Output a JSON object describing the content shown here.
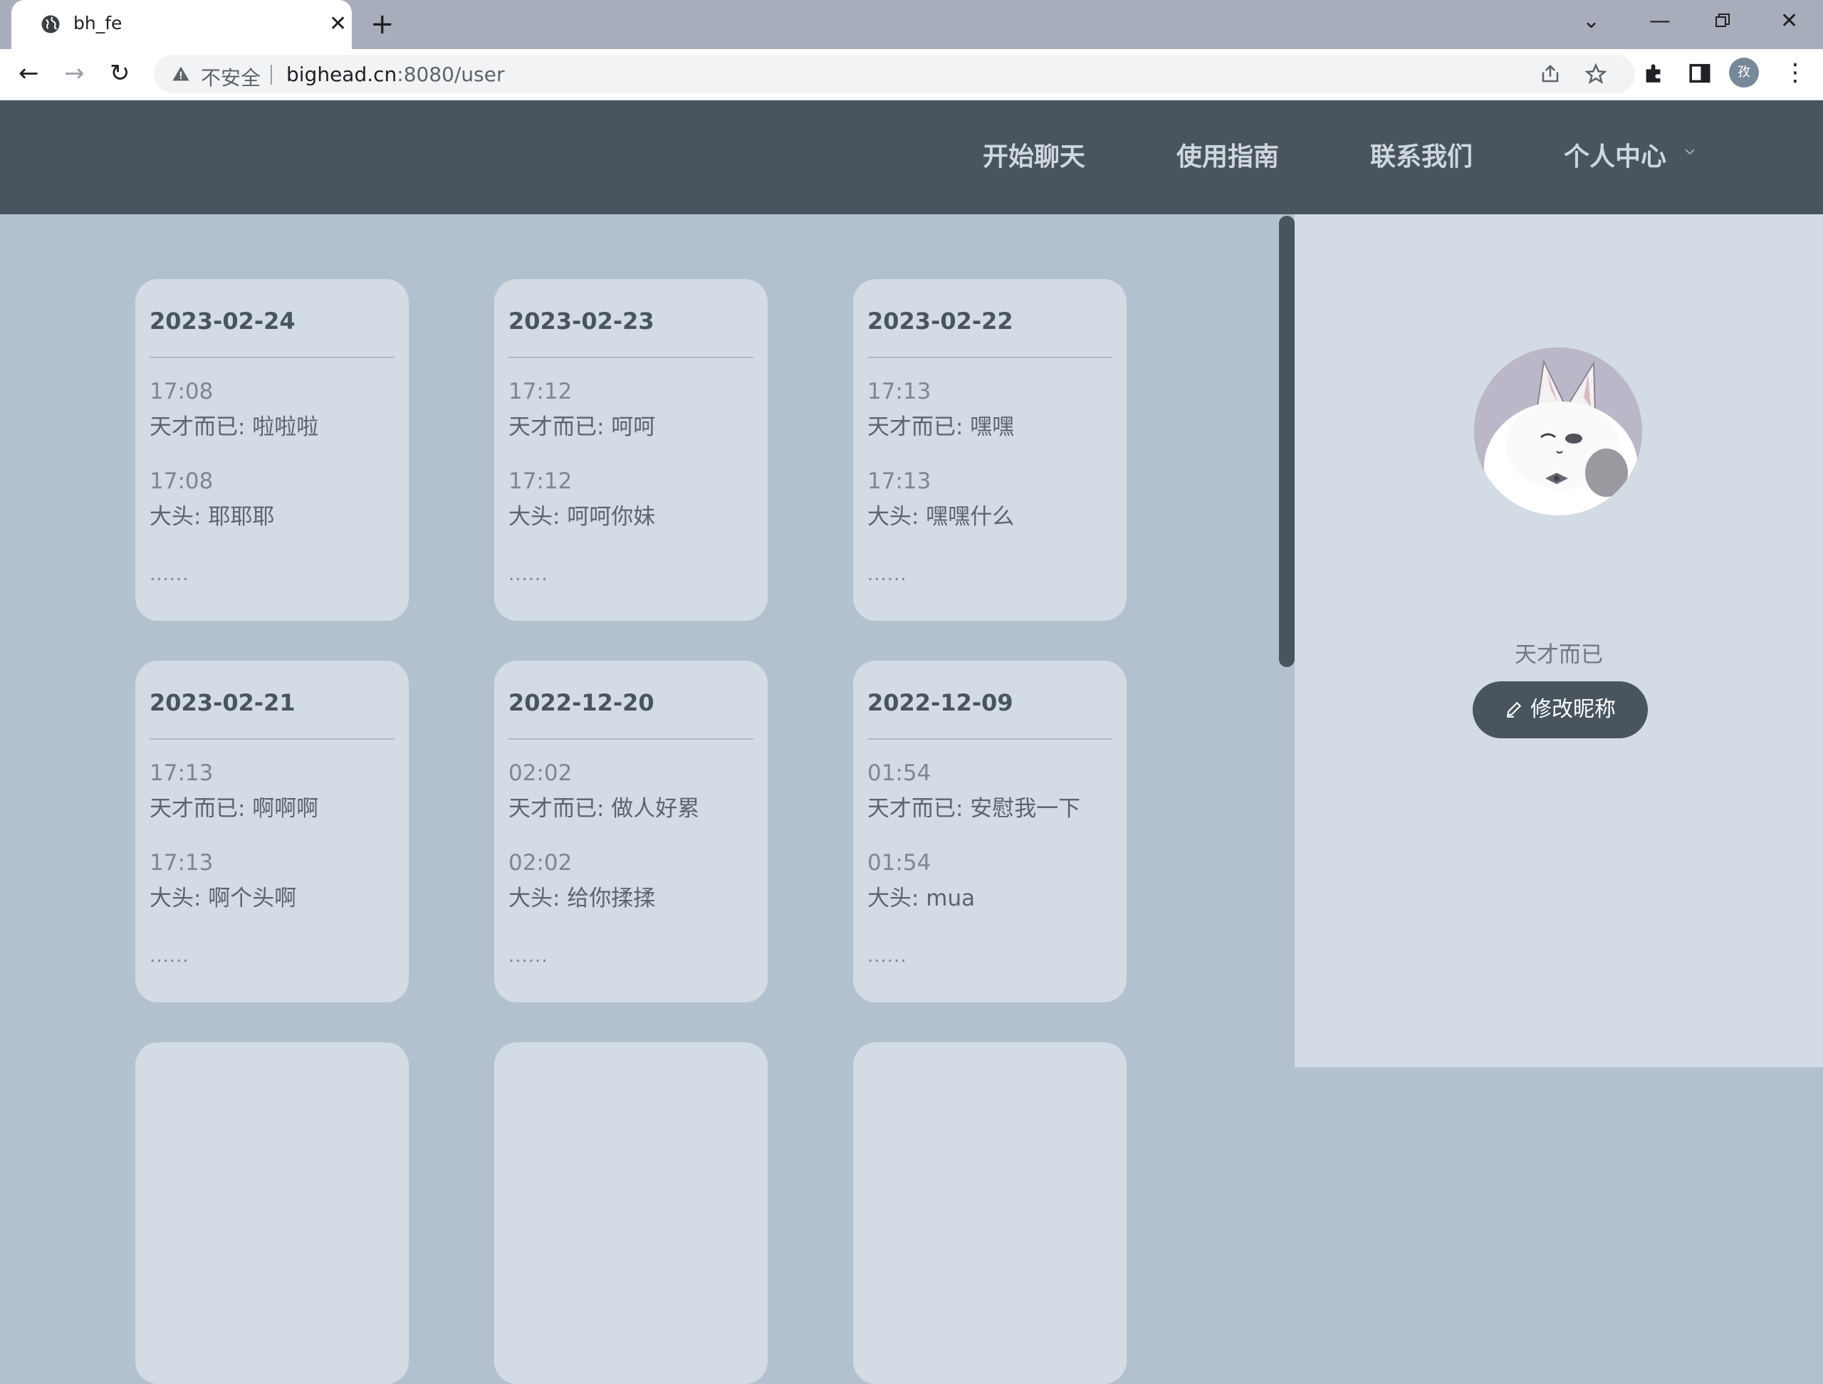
{
  "browser": {
    "tab_title": "bh_fe",
    "security_label": "不安全",
    "url_host": "bighead.cn",
    "url_path": ":8080/user",
    "profile_initial": "孜"
  },
  "nav": {
    "items": [
      "开始聊天",
      "使用指南",
      "联系我们",
      "个人中心"
    ]
  },
  "cards": [
    {
      "date": "2023-02-24",
      "messages": [
        {
          "time": "17:08",
          "text": "天才而已: 啦啦啦"
        },
        {
          "time": "17:08",
          "text": "大头: 耶耶耶"
        }
      ],
      "more": "......"
    },
    {
      "date": "2023-02-23",
      "messages": [
        {
          "time": "17:12",
          "text": "天才而已: 呵呵"
        },
        {
          "time": "17:12",
          "text": "大头: 呵呵你妹"
        }
      ],
      "more": "......"
    },
    {
      "date": "2023-02-22",
      "messages": [
        {
          "time": "17:13",
          "text": "天才而已: 嘿嘿"
        },
        {
          "time": "17:13",
          "text": "大头: 嘿嘿什么"
        }
      ],
      "more": "......"
    },
    {
      "date": "2023-02-21",
      "messages": [
        {
          "time": "17:13",
          "text": "天才而已: 啊啊啊"
        },
        {
          "time": "17:13",
          "text": "大头: 啊个头啊"
        }
      ],
      "more": "......"
    },
    {
      "date": "2022-12-20",
      "messages": [
        {
          "time": "02:02",
          "text": "天才而已: 做人好累"
        },
        {
          "time": "02:02",
          "text": "大头: 给你揉揉"
        }
      ],
      "more": "......"
    },
    {
      "date": "2022-12-09",
      "messages": [
        {
          "time": "01:54",
          "text": "天才而已: 安慰我一下"
        },
        {
          "time": "01:54",
          "text": "大头: mua"
        }
      ],
      "more": "......"
    }
  ],
  "profile": {
    "nickname": "天才而已",
    "edit_button_label": "修改昵称"
  },
  "colors": {
    "header_bg": "#48555f",
    "content_bg": "#b3c0ce",
    "card_bg": "#d3dbe4",
    "button_bg": "#48555f"
  }
}
